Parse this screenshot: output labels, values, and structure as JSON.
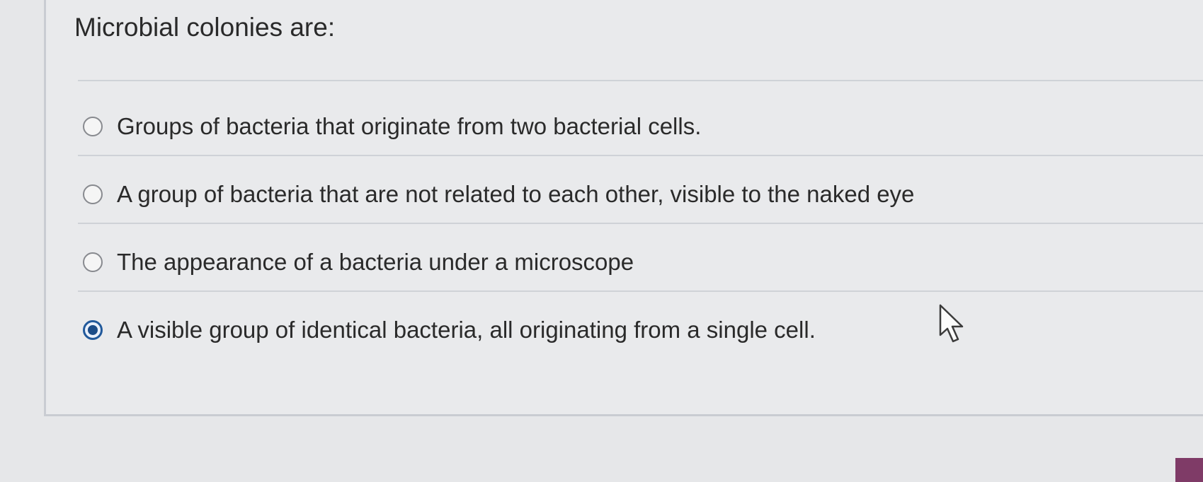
{
  "question": {
    "text": "Microbial colonies are:"
  },
  "options": [
    {
      "label": "Groups of bacteria that originate from two bacterial cells.",
      "selected": false
    },
    {
      "label": "A group of bacteria that are not related to each other, visible to the naked eye",
      "selected": false
    },
    {
      "label": "The appearance of a bacteria under a microscope",
      "selected": false
    },
    {
      "label": "A visible group of identical bacteria, all originating from a single cell.",
      "selected": true
    }
  ],
  "icons": {
    "cursor": "mouse-pointer-icon",
    "radio_unselected": "radio-button-empty-icon",
    "radio_selected": "radio-button-filled-icon"
  },
  "colors": {
    "accent": "#21599b",
    "background": "#e6e7e9",
    "divider": "#cfd2d7",
    "corner_block": "#7f3b67"
  }
}
